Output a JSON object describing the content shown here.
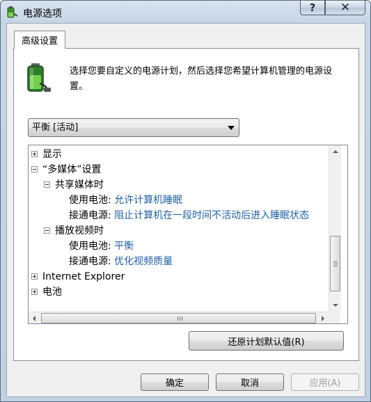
{
  "window": {
    "title": "电源选项",
    "help_label": "?",
    "close_label": "✕"
  },
  "tab": {
    "label": "高级设置"
  },
  "description": "选择您要自定义的电源计划，然后选择您希望计算机管理的电源设置。",
  "plan_select": {
    "value": "平衡 [活动]"
  },
  "tree": {
    "display": "显示",
    "multimedia": "“多媒体”设置",
    "sharing": "共享媒体时",
    "sharing_battery_label": "使用电池:",
    "sharing_battery_value": "允许计算机睡眠",
    "sharing_plugged_label": "接通电源:",
    "sharing_plugged_value": "阻止计算机在一段时间不活动后进入睡眠状态",
    "video": "播放视频时",
    "video_battery_label": "使用电池:",
    "video_battery_value": "平衡",
    "video_plugged_label": "接通电源:",
    "video_plugged_value": "优化视频质量",
    "ie": "Internet Explorer",
    "battery": "电池"
  },
  "buttons": {
    "restore": "还原计划默认值(R)",
    "ok": "确定",
    "cancel": "取消",
    "apply": "应用(A)"
  },
  "colors": {
    "link": "#1f5fa8",
    "titlebar": "#c6d6e6"
  }
}
